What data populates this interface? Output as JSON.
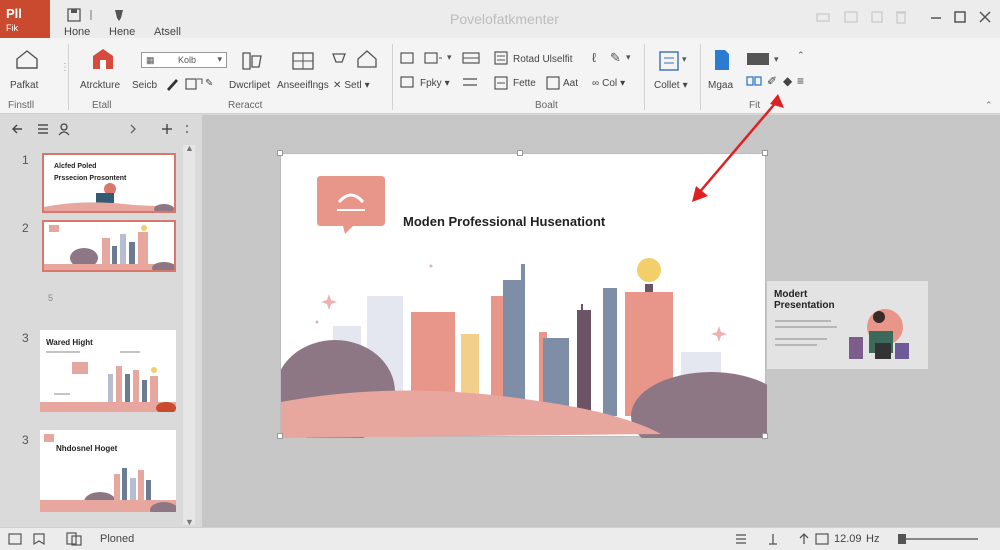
{
  "app": {
    "logo_line1": "Pll",
    "logo_line2": "Fik",
    "title": "Povelofatkmenter"
  },
  "tabs": [
    "Hone",
    "Hene",
    "Atsell"
  ],
  "ribbon": {
    "home_label": "Pafkat",
    "group1_label": "Finstll",
    "group2_label": "Etall",
    "group3_label": "Reracct",
    "group4_label": "Boalt",
    "group5_label": "Fit",
    "architecture": "Atrckture",
    "select": "Seicb",
    "developer": "Dwcrlipet",
    "arrangements": "Anseeiflngs",
    "sett": "Setl",
    "style_dropdown": "Kolb",
    "fpky": "Fpky",
    "rotad": "Rotad Ulselfit",
    "fette": "Fette",
    "aat": "Aat",
    "col": "Col",
    "collect": "Collet",
    "mgaa": "Mgaa"
  },
  "slides": [
    {
      "num": "1",
      "title": "Alcfed Poled",
      "subtitle": "Prssecion Prosontent"
    },
    {
      "num": "2"
    },
    {
      "num": "3",
      "title": "Wared Hight"
    },
    {
      "num": "3",
      "title": "Nhdosnel Hoget"
    }
  ],
  "slide_list_marker": "5",
  "main_slide": {
    "title": "Moden Professional Husenationt"
  },
  "side_card": {
    "title": "Modert Presentation"
  },
  "status": {
    "label": "Ploned",
    "time": "12.09",
    "time_suffix": "Hz"
  },
  "colors": {
    "accent": "#c94a2f",
    "salmon": "#e8a79e",
    "mauve": "#8e7784",
    "arrow": "#e02020"
  }
}
